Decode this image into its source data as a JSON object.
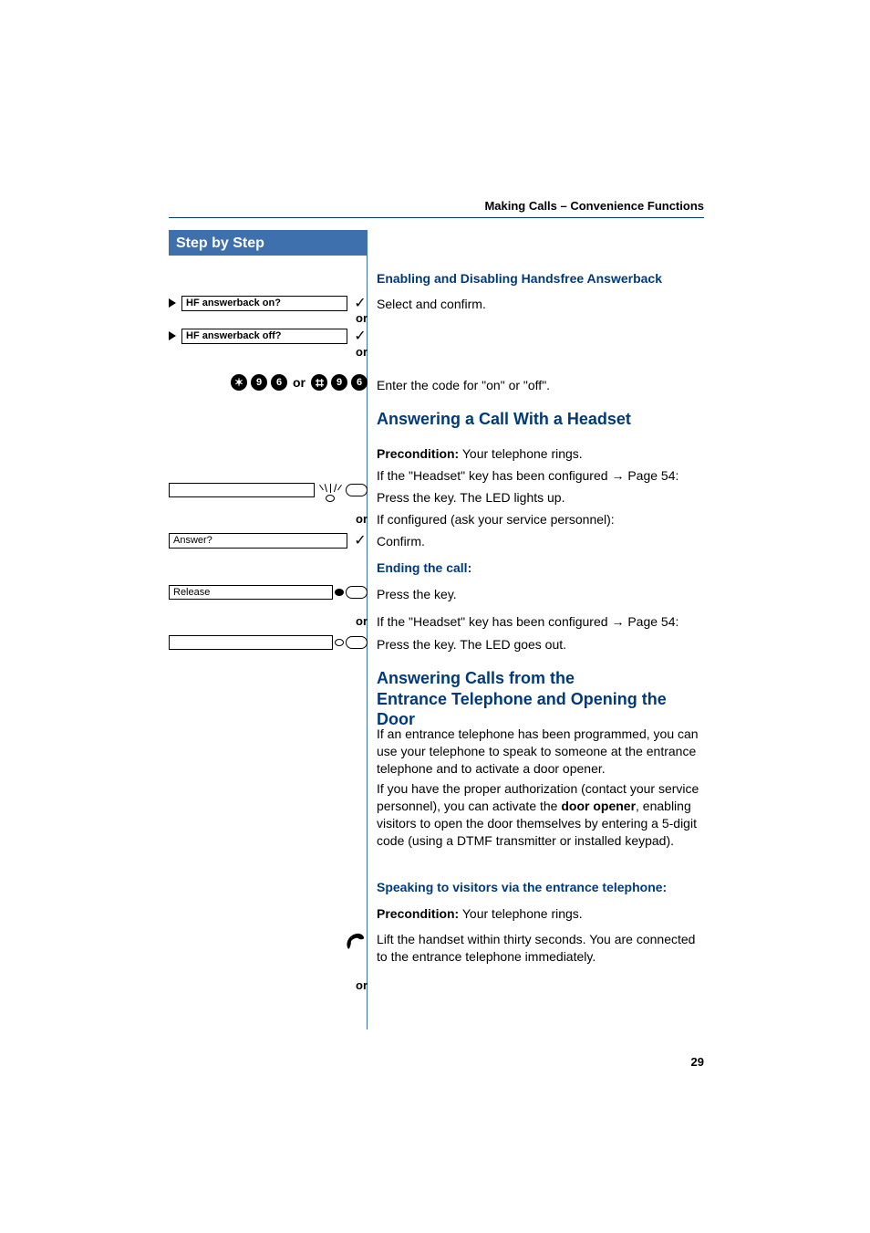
{
  "header": {
    "breadcrumb": "Making Calls – Convenience Functions"
  },
  "sidebar": {
    "title": "Step by Step"
  },
  "sections": {
    "hf": {
      "title": "Enabling and Disabling Handsfree Answerback",
      "select_confirm": "Select and confirm.",
      "on_option": "HF answerback on?",
      "off_option": "HF answerback off?",
      "or1": "or",
      "or2": "or",
      "code_separator": "or",
      "code_a": [
        "key-star",
        "9",
        "6"
      ],
      "code_b": [
        "key-hash",
        "9",
        "6"
      ],
      "enter_code": "Enter the code for \"on\" or \"off\"."
    },
    "headset": {
      "title": "Answering a Call With a Headset",
      "precond_label": "Precondition:",
      "precond_text": " Your telephone rings.",
      "if_headset_key": "If the \"Headset\" key has been configured ",
      "page_ref": "Page 54:",
      "press_led_up": "Press the key. The LED lights up.",
      "or1": "or",
      "if_configured": "If configured (ask your service personnel):",
      "answer_option": "Answer?",
      "confirm": "Confirm.",
      "ending_title": "Ending the call:",
      "release_label": "Release",
      "press_key": "Press the key.",
      "or2": "or",
      "if_headset_key2": "If the \"Headset\" key has been configured ",
      "page_ref2": "Page 54:",
      "press_led_out": "Press the key. The LED goes out."
    },
    "entrance": {
      "title_line1": "Answering Calls from the",
      "title_line2": "Entrance Telephone and Opening the Door",
      "para1": "If an entrance telephone has been programmed, you can use your telephone to speak to someone at the entrance telephone and to activate a door opener.",
      "para2a": "If you have the proper authorization (contact your service personnel), you can activate the ",
      "door_opener": "door opener",
      "para2b": ", enabling visitors to open the door themselves by entering a 5-digit code (using a DTMF transmitter or installed keypad).",
      "speaking_title": "Speaking to visitors via the entrance telephone:",
      "precond_label": "Precondition:",
      "precond_text": " Your telephone rings.",
      "lift_handset": "Lift the handset within thirty seconds. You are connected to the entrance telephone immediately.",
      "or": "or"
    }
  },
  "page_number": "29"
}
